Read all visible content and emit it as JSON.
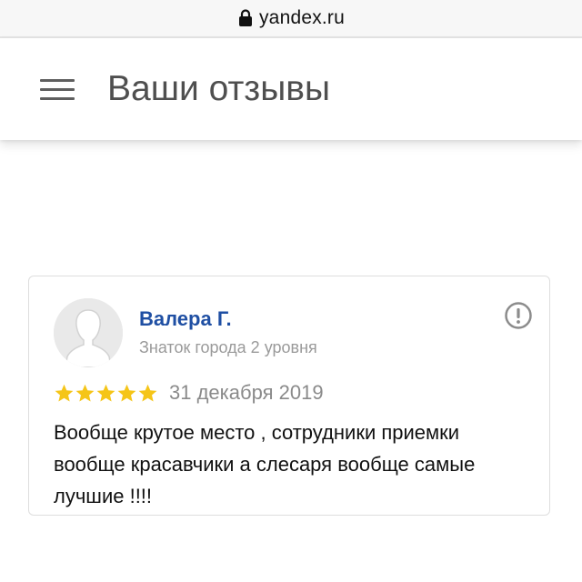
{
  "browser": {
    "domain": "yandex.ru",
    "lock_icon": "lock-icon"
  },
  "header": {
    "menu_icon": "hamburger-menu-icon",
    "title": "Ваши отзывы"
  },
  "review": {
    "author_name": "Валера Г.",
    "author_status": "Знаток города 2 уровня",
    "avatar_icon": "user-silhouette-icon",
    "report_icon": "exclamation-circle-icon",
    "rating": 5,
    "rating_max": 5,
    "date": "31 декабря 2019",
    "text": "Вообще крутое место , сотрудники приемки вообще красавчики а слесаря вообще самые лучшие !!!!"
  },
  "colors": {
    "author_link": "#1f4fa3",
    "star": "#f5c518",
    "title": "#4f4f4f",
    "muted": "#9a9a9a"
  }
}
